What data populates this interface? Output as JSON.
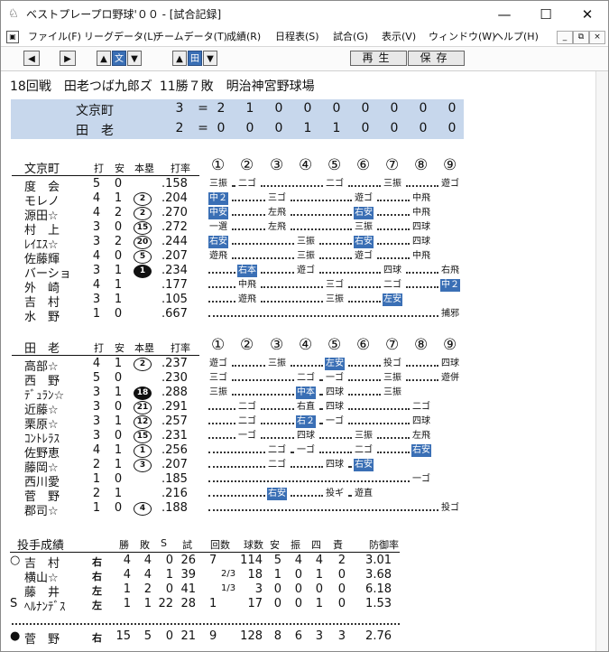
{
  "window": {
    "title": "ベストプレープロ野球'００ - [試合記録]",
    "icon": "baseball-cap-icon"
  },
  "menu": [
    "ファイル(F)",
    "リーグデータ(L)",
    "チームデータ(T)",
    "成績(R)",
    "日程表(S)",
    "試合(G)",
    "表示(V)",
    "ウィンドウ(W)",
    "ヘルプ(H)"
  ],
  "toolbar": {
    "bun": "文",
    "ta": "田",
    "play": "再生",
    "save": "保存"
  },
  "header": {
    "game": "18回戦",
    "winner": "田老つば九郎ズ",
    "record": "11勝７敗",
    "stadium": "明治神宮野球場"
  },
  "scoreboard": [
    {
      "team": "文京町",
      "runs": "3",
      "eq": "=",
      "innings": [
        "2",
        "1",
        "0",
        "0",
        "0",
        "0",
        "0",
        "0",
        "0"
      ]
    },
    {
      "team": "田　老",
      "runs": "2",
      "eq": "=",
      "innings": [
        "0",
        "0",
        "0",
        "1",
        "1",
        "0",
        "0",
        "0",
        "0"
      ]
    }
  ],
  "columns": {
    "ab": "打",
    "h": "安",
    "hr": "本塁",
    "avg": "打率",
    "inning_marks": [
      "①",
      "②",
      "③",
      "④",
      "⑤",
      "⑥",
      "⑦",
      "⑧",
      "⑨"
    ]
  },
  "away": {
    "team": "文京町",
    "rows": [
      {
        "name": "度　会",
        "ab": "5",
        "h": "0",
        "hr": "",
        "avg": ".158",
        "res": [
          [
            "三振",
            0,
            0
          ],
          [
            "二ゴ",
            1,
            0
          ],
          [
            "二ゴ",
            4,
            0
          ],
          [
            "三振",
            6,
            0
          ],
          [
            "遊ゴ",
            8,
            0
          ]
        ]
      },
      {
        "name": "モレノ",
        "ab": "4",
        "h": "1",
        "hr": "2",
        "avg": ".204",
        "res": [
          [
            "中２",
            0,
            1
          ],
          [
            "三ゴ",
            2,
            0
          ],
          [
            "遊ゴ",
            5,
            0
          ],
          [
            "中飛",
            7,
            0
          ]
        ]
      },
      {
        "name": "源田☆",
        "ab": "4",
        "h": "2",
        "hr": "2",
        "avg": ".270",
        "res": [
          [
            "中安",
            0,
            1
          ],
          [
            "左飛",
            2,
            0
          ],
          [
            "右安",
            5,
            1
          ],
          [
            "中飛",
            7,
            0
          ]
        ]
      },
      {
        "name": "村　上",
        "ab": "3",
        "h": "0",
        "hr": "15",
        "avg": ".272",
        "res": [
          [
            "一選",
            0,
            0
          ],
          [
            "左飛",
            2,
            0
          ],
          [
            "三振",
            5,
            0
          ],
          [
            "四球",
            7,
            0
          ]
        ]
      },
      {
        "name": "ﾚｲｴｽ☆",
        "ab": "3",
        "h": "2",
        "hr": "20",
        "avg": ".244",
        "res": [
          [
            "右安",
            0,
            1
          ],
          [
            "三振",
            3,
            0
          ],
          [
            "右安",
            5,
            1
          ],
          [
            "四球",
            7,
            0
          ]
        ]
      },
      {
        "name": "佐藤輝",
        "ab": "4",
        "h": "0",
        "hr": "5",
        "avg": ".207",
        "res": [
          [
            "遊飛",
            0,
            0
          ],
          [
            "三振",
            3,
            0
          ],
          [
            "遊ゴ",
            5,
            0
          ],
          [
            "中飛",
            7,
            0
          ]
        ]
      },
      {
        "name": "バーショ",
        "ab": "3",
        "h": "1",
        "hr": "1",
        "hrfill": true,
        "avg": ".234",
        "res": [
          [
            "右本",
            1,
            1
          ],
          [
            "遊ゴ",
            3,
            0
          ],
          [
            "四球",
            6,
            0
          ],
          [
            "右飛",
            8,
            0
          ]
        ]
      },
      {
        "name": "外　崎",
        "ab": "4",
        "h": "1",
        "hr": "",
        "avg": ".177",
        "res": [
          [
            "中飛",
            1,
            0
          ],
          [
            "三ゴ",
            4,
            0
          ],
          [
            "二ゴ",
            6,
            0
          ],
          [
            "中２",
            8,
            1
          ]
        ]
      },
      {
        "name": "吉　村",
        "ab": "3",
        "h": "1",
        "hr": "",
        "avg": ".105",
        "res": [
          [
            "遊飛",
            1,
            0
          ],
          [
            "三振",
            4,
            0
          ],
          [
            "左安",
            6,
            1
          ]
        ]
      },
      {
        "name": "水　野",
        "ab": "1",
        "h": "0",
        "hr": "",
        "avg": ".667",
        "res": [
          [
            "捕邪",
            8,
            0
          ]
        ]
      }
    ]
  },
  "home": {
    "team": "田　老",
    "rows": [
      {
        "name": "高部☆",
        "ab": "4",
        "h": "1",
        "hr": "2",
        "avg": ".237",
        "res": [
          [
            "遊ゴ",
            0,
            0
          ],
          [
            "三振",
            2,
            0
          ],
          [
            "左安",
            4,
            1
          ],
          [
            "投ゴ",
            6,
            0
          ],
          [
            "四球",
            8,
            0
          ]
        ]
      },
      {
        "name": "西　野",
        "ab": "5",
        "h": "0",
        "hr": "",
        "avg": ".230",
        "res": [
          [
            "三ゴ",
            0,
            0
          ],
          [
            "二ゴ",
            3,
            0
          ],
          [
            "一ゴ",
            4,
            0
          ],
          [
            "三振",
            6,
            0
          ],
          [
            "遊併",
            8,
            0
          ]
        ]
      },
      {
        "name": "ﾃﾞｭﾗﾝ☆",
        "ab": "3",
        "h": "1",
        "hr": "18",
        "hrfill": true,
        "avg": ".288",
        "res": [
          [
            "三振",
            0,
            0
          ],
          [
            "中本",
            3,
            1
          ],
          [
            "四球",
            4,
            0
          ],
          [
            "三振",
            6,
            0
          ]
        ]
      },
      {
        "name": "近藤☆",
        "ab": "3",
        "h": "0",
        "hr": "21",
        "avg": ".291",
        "res": [
          [
            "二ゴ",
            1,
            0
          ],
          [
            "右直",
            3,
            0
          ],
          [
            "四球",
            4,
            0
          ],
          [
            "二ゴ",
            7,
            0
          ]
        ]
      },
      {
        "name": "栗原☆",
        "ab": "3",
        "h": "1",
        "hr": "12",
        "avg": ".257",
        "res": [
          [
            "二ゴ",
            1,
            0
          ],
          [
            "右２",
            3,
            1
          ],
          [
            "一ゴ",
            4,
            0
          ],
          [
            "四球",
            7,
            0
          ]
        ]
      },
      {
        "name": "ｺﾝﾄﾚﾗｽ",
        "ab": "3",
        "h": "0",
        "hr": "15",
        "avg": ".231",
        "res": [
          [
            "一ゴ",
            1,
            0
          ],
          [
            "四球",
            3,
            0
          ],
          [
            "三振",
            5,
            0
          ],
          [
            "左飛",
            7,
            0
          ]
        ]
      },
      {
        "name": "佐野恵",
        "ab": "4",
        "h": "1",
        "hr": "1",
        "avg": ".256",
        "res": [
          [
            "二ゴ",
            2,
            0
          ],
          [
            "一ゴ",
            3,
            0
          ],
          [
            "二ゴ",
            5,
            0
          ],
          [
            "右安",
            7,
            1
          ]
        ]
      },
      {
        "name": "藤岡☆",
        "ab": "2",
        "h": "1",
        "hr": "3",
        "avg": ".207",
        "res": [
          [
            "二ゴ",
            2,
            0
          ],
          [
            "四球",
            4,
            0
          ],
          [
            "右安",
            5,
            1
          ]
        ]
      },
      {
        "name": "西川愛",
        "ab": "1",
        "h": "0",
        "hr": "",
        "avg": ".185",
        "res": [
          [
            "一ゴ",
            7,
            0
          ]
        ]
      },
      {
        "name": "菅　野",
        "ab": "2",
        "h": "1",
        "hr": "",
        "avg": ".216",
        "res": [
          [
            "右安",
            2,
            1
          ],
          [
            "投ギ",
            4,
            0
          ],
          [
            "遊直",
            5,
            0
          ]
        ]
      },
      {
        "name": "郡司☆",
        "ab": "1",
        "h": "0",
        "hr": "4",
        "avg": ".188",
        "res": [
          [
            "投ゴ",
            8,
            0
          ]
        ]
      }
    ]
  },
  "pitching": {
    "title": "投手成績",
    "headers": [
      "勝",
      "敗",
      "S",
      "試",
      "回数",
      "球数",
      "安",
      "振",
      "四",
      "責",
      "防御率"
    ],
    "away": [
      {
        "mark": "○",
        "name": "吉　村",
        "hand": "右",
        "w": "4",
        "l": "4",
        "s": "0",
        "g": "26",
        "ip": "7",
        "ipf": "",
        "bp": "114",
        "h": "5",
        "k": "4",
        "bb": "4",
        "er": "2",
        "era": "3.01"
      },
      {
        "mark": "",
        "name": "横山☆",
        "hand": "右",
        "w": "4",
        "l": "4",
        "s": "1",
        "g": "39",
        "ip": "",
        "ipf": "2/3",
        "bp": "18",
        "h": "1",
        "k": "0",
        "bb": "1",
        "er": "0",
        "era": "3.68"
      },
      {
        "mark": "",
        "name": "藤　井",
        "hand": "左",
        "w": "1",
        "l": "2",
        "s": "0",
        "g": "41",
        "ip": "",
        "ipf": "1/3",
        "bp": "3",
        "h": "0",
        "k": "0",
        "bb": "0",
        "er": "0",
        "era": "6.18"
      },
      {
        "mark": "S",
        "name": "ﾍﾙﾅﾝﾃﾞｽ",
        "hand": "左",
        "w": "1",
        "l": "1",
        "s": "22",
        "g": "28",
        "ip": "1",
        "ipf": "",
        "bp": "17",
        "h": "0",
        "k": "0",
        "bb": "1",
        "er": "0",
        "era": "1.53"
      }
    ],
    "home": [
      {
        "mark": "●",
        "name": "菅　野",
        "hand": "右",
        "w": "15",
        "l": "5",
        "s": "0",
        "g": "21",
        "ip": "9",
        "ipf": "",
        "bp": "128",
        "h": "8",
        "k": "6",
        "bb": "3",
        "er": "3",
        "era": "2.76"
      }
    ]
  }
}
